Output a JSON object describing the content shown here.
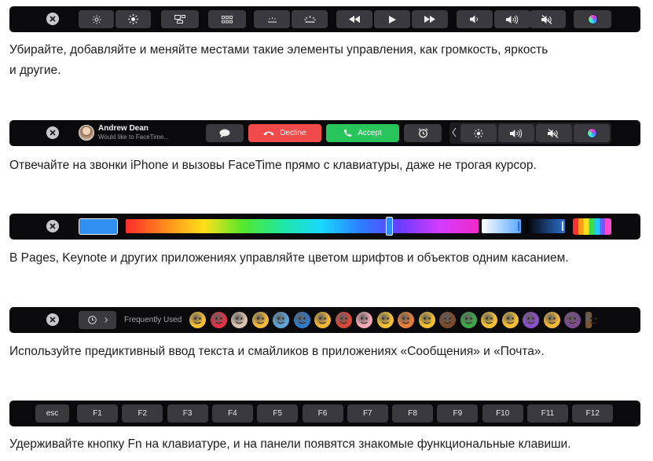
{
  "captions": {
    "c1_line1": "Убирайте, добавляйте и меняйте местами такие элементы управления, как громкость, яркость",
    "c1_line2": "и другие.",
    "c2": "Отвечайте на звонки iPhone и вызовы FaceTime прямо с клавиатуры, даже не трогая курсор.",
    "c3": "В Pages, Keynote и других приложениях управляйте цветом шрифтов и объектов одним касанием.",
    "c4": "Используйте предиктивный ввод текста и смайликов в приложениях «Сообщения» и «Почта».",
    "c5": "Удерживайте кнопку Fn на клавиатуре, и на панели появятся знакомые функциональные клавиши."
  },
  "call": {
    "caller_name": "Andrew Dean",
    "caller_sub": "Would like to FaceTime...",
    "decline_label": "Decline",
    "accept_label": "Accept"
  },
  "emoji_bar": {
    "label": "Frequently Used",
    "emoji_colors": [
      "#f6c033",
      "#e0334a",
      "#d9c4b0",
      "#f4b93a",
      "#5ea3d8",
      "#2f79c7",
      "#f2b636",
      "#d6493b",
      "#f4a9b8",
      "#f6c033",
      "#e77f3a",
      "#f2c12e",
      "#7a4a2b",
      "#3da84a",
      "#f6c033",
      "#f6c033",
      "#8b4fc9",
      "#f2b636",
      "#7b4a90",
      "#7a5330"
    ]
  },
  "fn_keys": {
    "esc": "esc",
    "keys": [
      "F1",
      "F2",
      "F3",
      "F4",
      "F5",
      "F6",
      "F7",
      "F8",
      "F9",
      "F10",
      "F11",
      "F12"
    ]
  },
  "colors": {
    "bar_bg": "#0a0a0c",
    "key_bg": "#3a3a3e",
    "decline": "#f04a4a",
    "accept": "#27c55a",
    "selected_color": "#2f8ff0"
  }
}
